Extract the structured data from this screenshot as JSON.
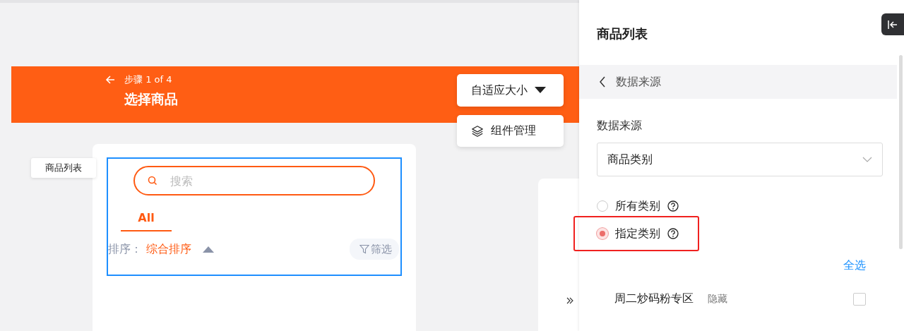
{
  "step": {
    "label": "步骤 1 of 4",
    "title": "选择商品"
  },
  "canvas_buttons": [
    {
      "kind": "dropdown",
      "label": "自适应大小"
    },
    {
      "kind": "layers",
      "label": "组件管理"
    }
  ],
  "widget": {
    "tag": "商品列表",
    "search": {
      "placeholder": "搜索"
    },
    "tabs": [
      {
        "label": "All",
        "selected": true
      }
    ],
    "sort": {
      "label": "排序：",
      "value": "综合排序"
    },
    "filter": "筛选"
  },
  "panel": {
    "title": "商品列表",
    "back": "数据来源",
    "field_label": "数据来源",
    "select_value": "商品类别",
    "options": [
      {
        "label": "所有类别",
        "selected": false,
        "highlighted": false
      },
      {
        "label": "指定类别",
        "selected": true,
        "highlighted": true
      }
    ],
    "select_all": "全选",
    "categories": [
      {
        "name": "周二炒码粉专区",
        "status": "隐藏",
        "checked": false
      }
    ]
  }
}
